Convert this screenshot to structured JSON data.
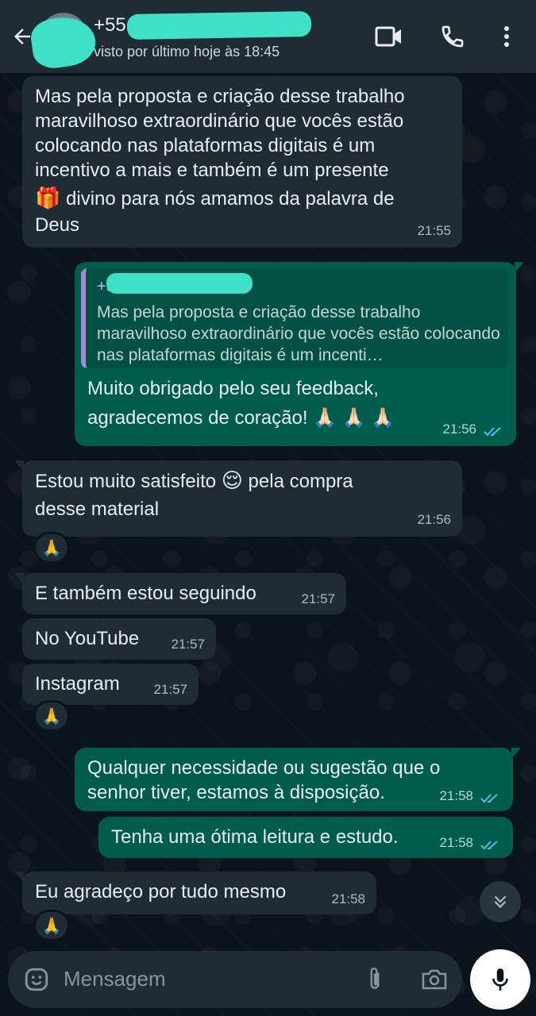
{
  "header": {
    "contact_name": "+55 8",
    "last_seen": "visto por último hoje às 18:45"
  },
  "messages": [
    {
      "direction": "in",
      "text_line1": "Mas pela proposta e criação desse trabalho",
      "text_line2": "maravilhoso extraordinário que vocês estão",
      "text_line3": "colocando nas plataformas digitais é um",
      "text_line4": "incentivo a mais e também é um presente",
      "emoji": "🎁",
      "text_line5": " divino para nós amamos da palavra de",
      "text_line6": "Deus",
      "time": "21:55"
    },
    {
      "direction": "out",
      "quote_author": "+5",
      "quote_text": "Mas pela proposta e criação desse trabalho maravilhoso extraordinário que vocês estão colocando nas plataformas digitais é um incenti…",
      "text_line1": "Muito obrigado pelo seu feedback,",
      "text_line2": "agradecemos de coração! 🙏🏻 🙏🏻 🙏🏻",
      "time": "21:56"
    },
    {
      "direction": "in",
      "text_line1a": "Estou muito satisfeito ",
      "emoji": "😌",
      "text_line1b": "  pela compra",
      "text_line2": "desse material",
      "time": "21:56",
      "reaction": "🙏"
    },
    {
      "direction": "in",
      "text": "E também estou seguindo",
      "time": "21:57"
    },
    {
      "direction": "in",
      "text": "No YouTube",
      "time": "21:57"
    },
    {
      "direction": "in",
      "text": "Instagram",
      "time": "21:57",
      "reaction": "🙏"
    },
    {
      "direction": "out",
      "text_line1": "Qualquer necessidade ou sugestão que o",
      "text_line2": "senhor tiver, estamos à disposição.",
      "time": "21:58"
    },
    {
      "direction": "out",
      "text": "Tenha uma ótima leitura e estudo.",
      "time": "21:58"
    },
    {
      "direction": "in",
      "text": "Eu agradeço por tudo mesmo",
      "time": "21:58",
      "reaction": "🙏"
    }
  ],
  "composer": {
    "placeholder": "Mensagem"
  },
  "colors": {
    "incoming_bubble": "#202c33",
    "outgoing_bubble": "#005c4b",
    "read_ticks": "#53bdeb",
    "header": "#1f2c34",
    "background": "#0b141a"
  },
  "icons": [
    "back-arrow-icon",
    "video-call-icon",
    "phone-icon",
    "more-vert-icon",
    "double-check-icon",
    "scroll-down-icon",
    "emoji-icon",
    "attach-icon",
    "camera-icon",
    "mic-icon"
  ]
}
